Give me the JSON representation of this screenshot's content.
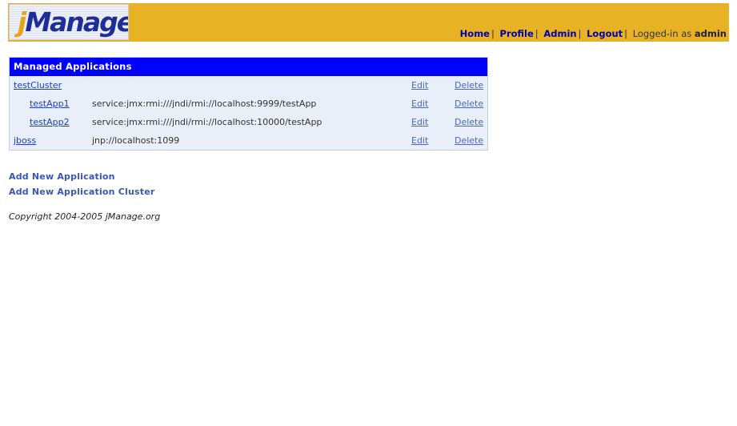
{
  "header": {
    "logo_j": "j",
    "logo_rest": "Manage",
    "nav": [
      {
        "label": "Home"
      },
      {
        "label": "Profile"
      },
      {
        "label": "Admin"
      },
      {
        "label": "Logout"
      }
    ],
    "separator": "|",
    "logged_in_prefix": "Logged-in as",
    "user": "admin"
  },
  "apps": {
    "title": "Managed Applications",
    "edit_label": "Edit",
    "delete_label": "Delete",
    "rows": [
      {
        "name": "testCluster",
        "url": ""
      },
      {
        "name": "testApp1",
        "url": "service:jmx:rmi:///jndi/rmi://localhost:9999/testApp"
      },
      {
        "name": "testApp2",
        "url": "service:jmx:rmi:///jndi/rmi://localhost:10000/testApp"
      },
      {
        "name": "jboss",
        "url": "jnp://localhost:1099"
      }
    ]
  },
  "actions": {
    "add_application": "Add New Application",
    "add_cluster": "Add New Application Cluster"
  },
  "footer": {
    "copyright": "Copyright 2004-2005 jManage.org"
  }
}
